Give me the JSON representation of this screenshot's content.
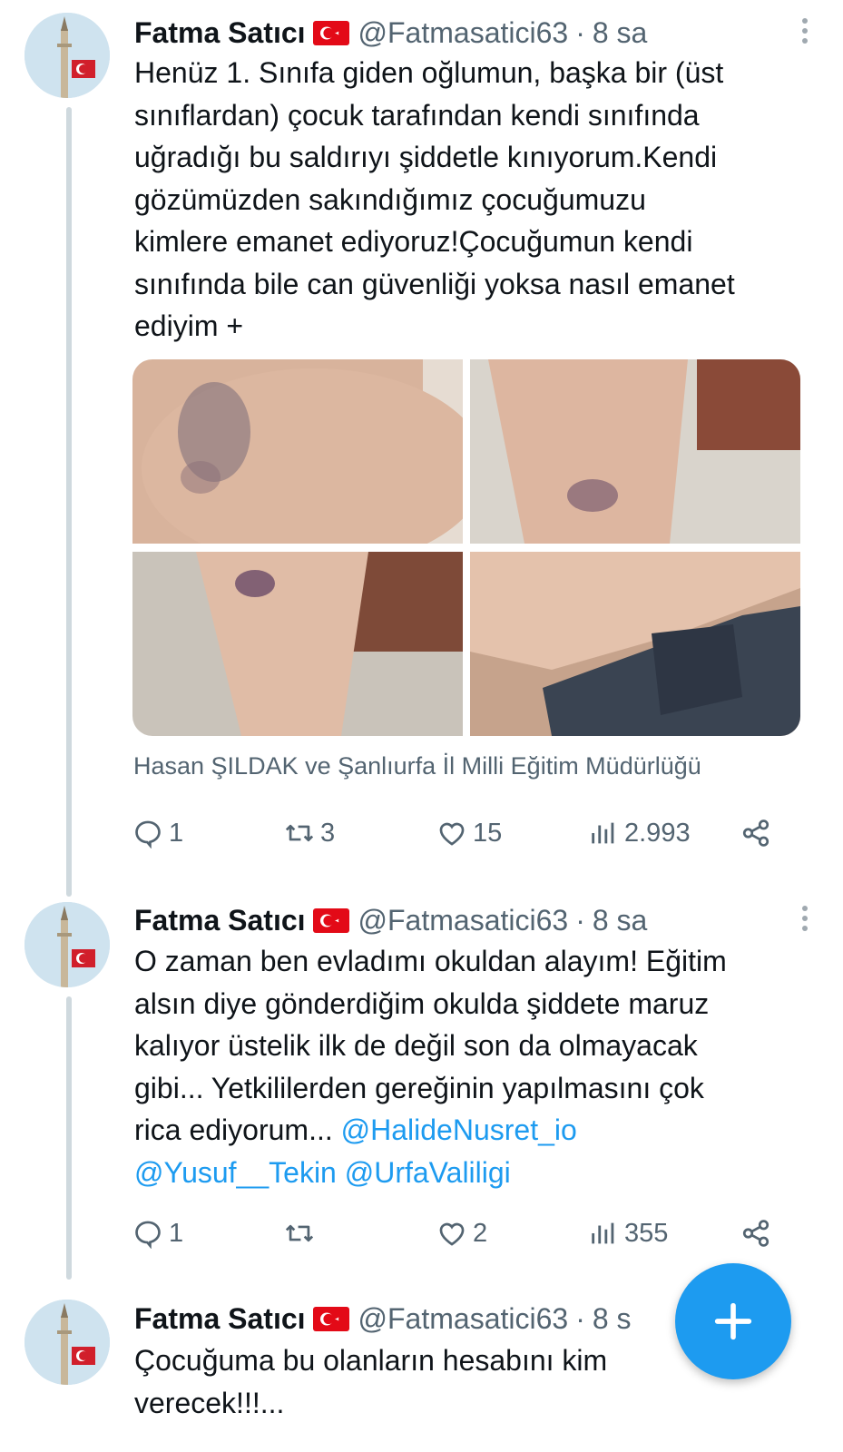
{
  "tweets": [
    {
      "name": "Fatma Satıcı",
      "handle": "@Fatmasatici63",
      "separator": "·",
      "time": "8 sa",
      "text_lines": [
        "Henüz 1. Sınıfa giden oğlumun, başka bir (üst",
        "sınıflardan) çocuk tarafından kendi sınıfında",
        "uğradığı bu saldırıyı şiddetle kınıyorum.Kendi",
        "gözümüzden sakındığımız çocuğumuzu",
        "kimlere emanet ediyoruz!Çocuğumun kendi",
        "sınıfında bile can güvenliği yoksa nasıl emanet",
        "ediyim  +"
      ],
      "tagged": "Hasan ŞILDAK ve Şanlıurfa İl Milli Eğitim Müdürlüğü",
      "replies": "1",
      "retweets": "3",
      "likes": "15",
      "views": "2.993"
    },
    {
      "name": "Fatma Satıcı",
      "handle": "@Fatmasatici63",
      "separator": "·",
      "time": "8 sa",
      "text_lines": [
        "O zaman ben evladımı okuldan alayım! Eğitim",
        "alsın diye gönderdiğim okulda şiddete maruz",
        "kalıyor üstelik ilk de değil son da olmayacak",
        "gibi... Yetkililerden gereğinin yapılmasını çok"
      ],
      "last_line_prefix": "rica ediyorum... ",
      "mentions_line1": "@HalideNusret_io",
      "mentions_line2": "@Yusuf__Tekin @UrfaValiligi",
      "replies": "1",
      "retweets": "",
      "likes": "2",
      "views": "355"
    },
    {
      "name": "Fatma Satıcı",
      "handle": "@Fatmasatici63",
      "separator": "·",
      "time": "8 s",
      "text_lines": [
        "Çocuğuma bu olanların hesabını kim",
        "verecek!!!..."
      ]
    }
  ],
  "icons": {
    "reply": "reply-icon",
    "retweet": "retweet-icon",
    "like": "heart-icon",
    "views": "views-icon",
    "share": "share-icon",
    "compose": "plus-icon",
    "more": "more-icon",
    "flag": "turkey-flag-icon"
  },
  "colors": {
    "accent": "#1d9bf0",
    "text": "#0f1419",
    "secondary": "#536471",
    "thread_line": "#cfd9de"
  }
}
